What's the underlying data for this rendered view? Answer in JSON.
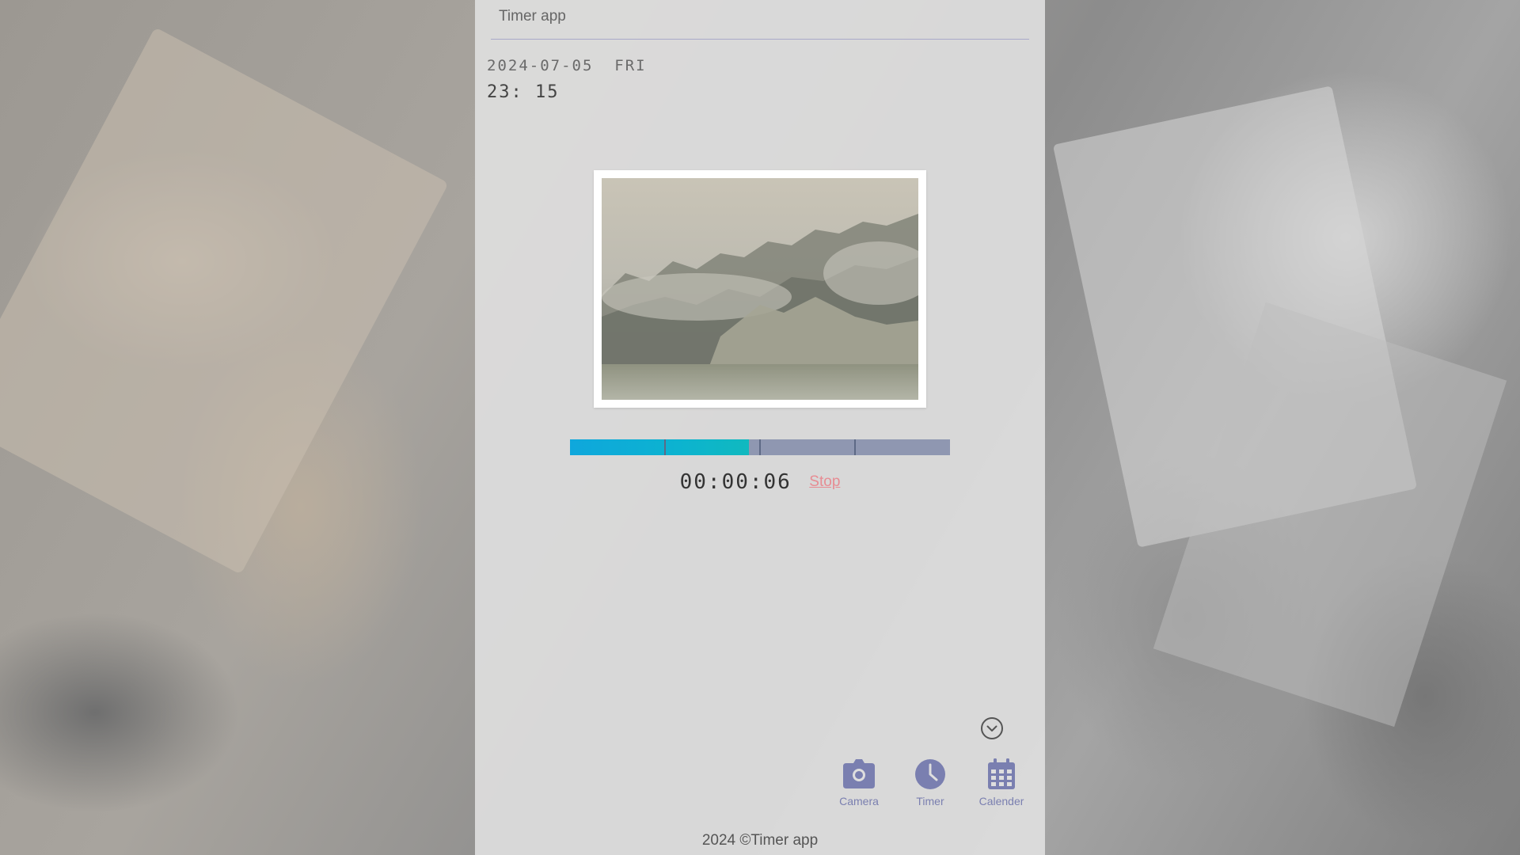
{
  "header": {
    "title": "Timer app"
  },
  "clock": {
    "date": "2024-07-05",
    "weekday": "FRI",
    "time": "23: 15"
  },
  "photo": {
    "icon": "misty-forest-landscape-photo"
  },
  "progress": {
    "fraction": 0.47,
    "segments": 4,
    "fill_color": "#0fa7dc",
    "track_color": "#8f97b1"
  },
  "timer": {
    "elapsed": "00:00:06",
    "stop_label": "Stop",
    "stop_color": "#e78c93"
  },
  "collapse": {
    "icon": "chevron-down-circle-icon"
  },
  "nav": {
    "items": [
      {
        "label": "Camera",
        "icon": "camera-icon"
      },
      {
        "label": "Timer",
        "icon": "clock-icon"
      },
      {
        "label": "Calender",
        "icon": "calendar-icon"
      }
    ],
    "accent": "#7a7fb0"
  },
  "footer": {
    "text": "2024 ©Timer app"
  }
}
